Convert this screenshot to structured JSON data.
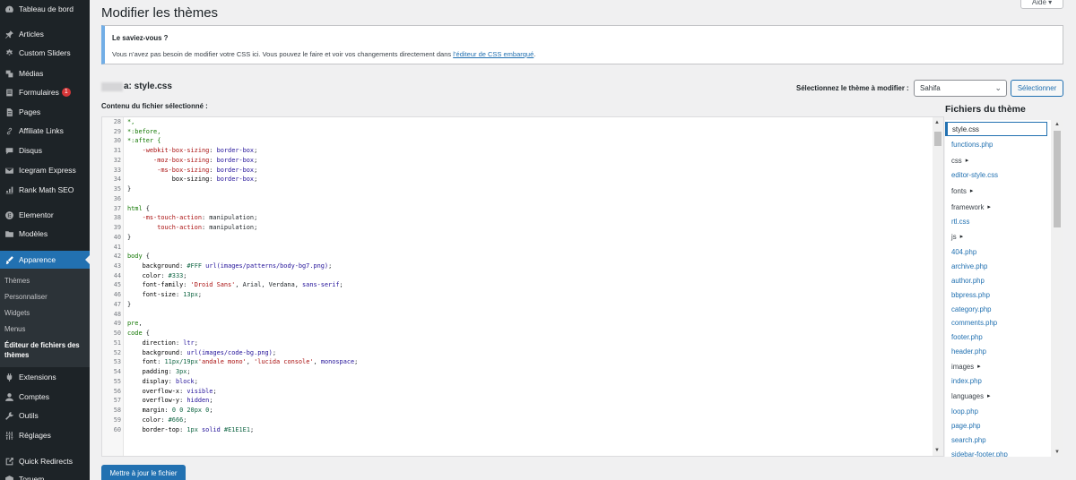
{
  "sidebar": {
    "items": [
      {
        "label": "Tableau de bord",
        "icon": "dashboard-icon"
      },
      {
        "label": "Articles",
        "icon": "pin-icon"
      },
      {
        "label": "Custom Sliders",
        "icon": "gear-icon"
      },
      {
        "label": "Médias",
        "icon": "media-icon"
      },
      {
        "label": "Formulaires",
        "icon": "forms-icon",
        "badge": "1"
      },
      {
        "label": "Pages",
        "icon": "page-icon"
      },
      {
        "label": "Affiliate Links",
        "icon": "link-icon"
      },
      {
        "label": "Disqus",
        "icon": "comment-icon"
      },
      {
        "label": "Icegram Express",
        "icon": "mail-icon"
      },
      {
        "label": "Rank Math SEO",
        "icon": "chart-icon"
      },
      {
        "label": "Elementor",
        "icon": "elementor-icon"
      },
      {
        "label": "Modèles",
        "icon": "folder-icon"
      },
      {
        "label": "Apparence",
        "icon": "brush-icon"
      },
      {
        "label": "Extensions",
        "icon": "plugin-icon"
      },
      {
        "label": "Comptes",
        "icon": "user-icon"
      },
      {
        "label": "Outils",
        "icon": "wrench-icon"
      },
      {
        "label": "Réglages",
        "icon": "settings-icon"
      },
      {
        "label": "Quick Redirects",
        "icon": "redirect-icon"
      },
      {
        "label": "Toruem",
        "icon": "cube-icon"
      }
    ],
    "submenu": [
      "Thèmes",
      "Personnaliser",
      "Widgets",
      "Menus",
      "Éditeur de fichiers des thèmes"
    ]
  },
  "page": {
    "title": "Modifier les thèmes",
    "help": "Aide ▾"
  },
  "notice": {
    "title": "Le saviez-vous ?",
    "text": "Vous n’avez pas besoin de modifier votre CSS ici. Vous pouvez le faire et voir vos changements directement dans ",
    "link": "l’éditeur de CSS embarqué",
    "end": "."
  },
  "file_heading": "a: style.css",
  "theme_select": {
    "label": "Sélectionnez le thème à modifier :",
    "value": "Sahifa",
    "button": "Sélectionner"
  },
  "content_label": "Contenu du fichier sélectionné :",
  "code_lines": [
    {
      "n": "28",
      "t": [
        [
          "*,",
          "tok-sel"
        ]
      ]
    },
    {
      "n": "29",
      "t": [
        [
          "*:before,",
          "tok-sel"
        ]
      ]
    },
    {
      "n": "30",
      "t": [
        [
          "*:after {",
          "tok-sel"
        ]
      ]
    },
    {
      "n": "31",
      "t": [
        [
          "    -webkit-box-sizing",
          "tok-vendor"
        ],
        [
          ": ",
          ""
        ],
        [
          "border-box",
          "tok-val"
        ],
        [
          ";",
          ""
        ]
      ]
    },
    {
      "n": "32",
      "t": [
        [
          "       -moz-box-sizing",
          "tok-vendor"
        ],
        [
          ": ",
          ""
        ],
        [
          "border-box",
          "tok-val"
        ],
        [
          ";",
          ""
        ]
      ]
    },
    {
      "n": "33",
      "t": [
        [
          "        -ms-box-sizing",
          "tok-vendor"
        ],
        [
          ": ",
          ""
        ],
        [
          "border-box",
          "tok-val"
        ],
        [
          ";",
          ""
        ]
      ]
    },
    {
      "n": "34",
      "t": [
        [
          "            box-sizing",
          "tok-prop"
        ],
        [
          ": ",
          ""
        ],
        [
          "border-box",
          "tok-val"
        ],
        [
          ";",
          ""
        ]
      ]
    },
    {
      "n": "35",
      "t": [
        [
          "}",
          ""
        ]
      ]
    },
    {
      "n": "36",
      "t": []
    },
    {
      "n": "37",
      "t": [
        [
          "html",
          "tok-sel"
        ],
        [
          " {",
          ""
        ]
      ]
    },
    {
      "n": "38",
      "t": [
        [
          "    -ms-touch-action",
          "tok-vendor"
        ],
        [
          ": manipulation;",
          ""
        ]
      ]
    },
    {
      "n": "39",
      "t": [
        [
          "        touch-action",
          "tok-vendor"
        ],
        [
          ": manipulation;",
          ""
        ]
      ]
    },
    {
      "n": "40",
      "t": [
        [
          "}",
          ""
        ]
      ]
    },
    {
      "n": "41",
      "t": []
    },
    {
      "n": "42",
      "t": [
        [
          "body",
          "tok-sel"
        ],
        [
          " {",
          ""
        ]
      ]
    },
    {
      "n": "43",
      "t": [
        [
          "    background",
          "tok-prop"
        ],
        [
          ": ",
          ""
        ],
        [
          "#FFF",
          "tok-num"
        ],
        [
          " ",
          ""
        ],
        [
          "url(images/patterns/body-bg7.png)",
          "tok-val"
        ],
        [
          ";",
          ""
        ]
      ]
    },
    {
      "n": "44",
      "t": [
        [
          "    color",
          "tok-prop"
        ],
        [
          ": ",
          ""
        ],
        [
          "#333",
          "tok-num"
        ],
        [
          ";",
          ""
        ]
      ]
    },
    {
      "n": "45",
      "t": [
        [
          "    font-family",
          "tok-prop"
        ],
        [
          ": ",
          ""
        ],
        [
          "'Droid Sans'",
          "tok-str"
        ],
        [
          ", Arial, Verdana, ",
          ""
        ],
        [
          "sans-serif",
          "tok-val"
        ],
        [
          ";",
          ""
        ]
      ]
    },
    {
      "n": "46",
      "t": [
        [
          "    font-size",
          "tok-prop"
        ],
        [
          ": ",
          ""
        ],
        [
          "13px",
          "tok-num"
        ],
        [
          ";",
          ""
        ]
      ]
    },
    {
      "n": "47",
      "t": [
        [
          "}",
          ""
        ]
      ]
    },
    {
      "n": "48",
      "t": []
    },
    {
      "n": "49",
      "t": [
        [
          "pre",
          "tok-sel"
        ],
        [
          ",",
          ""
        ]
      ]
    },
    {
      "n": "50",
      "t": [
        [
          "code",
          "tok-sel"
        ],
        [
          " {",
          ""
        ]
      ]
    },
    {
      "n": "51",
      "t": [
        [
          "    direction",
          "tok-prop"
        ],
        [
          ": ",
          ""
        ],
        [
          "ltr",
          "tok-val"
        ],
        [
          ";",
          ""
        ]
      ]
    },
    {
      "n": "52",
      "t": [
        [
          "    background",
          "tok-prop"
        ],
        [
          ": ",
          ""
        ],
        [
          "url(images/code-bg.png)",
          "tok-val"
        ],
        [
          ";",
          ""
        ]
      ]
    },
    {
      "n": "53",
      "t": [
        [
          "    font",
          "tok-prop"
        ],
        [
          ": ",
          ""
        ],
        [
          "11px/19px",
          "tok-num"
        ],
        [
          "'andale mono'",
          "tok-str"
        ],
        [
          ", ",
          ""
        ],
        [
          "'lucida console'",
          "tok-str"
        ],
        [
          ", ",
          ""
        ],
        [
          "monospace",
          "tok-val"
        ],
        [
          ";",
          ""
        ]
      ]
    },
    {
      "n": "54",
      "t": [
        [
          "    padding",
          "tok-prop"
        ],
        [
          ": ",
          ""
        ],
        [
          "3px",
          "tok-num"
        ],
        [
          ";",
          ""
        ]
      ]
    },
    {
      "n": "55",
      "t": [
        [
          "    display",
          "tok-prop"
        ],
        [
          ": ",
          ""
        ],
        [
          "block",
          "tok-val"
        ],
        [
          ";",
          ""
        ]
      ]
    },
    {
      "n": "56",
      "t": [
        [
          "    overflow-x",
          "tok-prop"
        ],
        [
          ": ",
          ""
        ],
        [
          "visible",
          "tok-val"
        ],
        [
          ";",
          ""
        ]
      ]
    },
    {
      "n": "57",
      "t": [
        [
          "    overflow-y",
          "tok-prop"
        ],
        [
          ": ",
          ""
        ],
        [
          "hidden",
          "tok-val"
        ],
        [
          ";",
          ""
        ]
      ]
    },
    {
      "n": "58",
      "t": [
        [
          "    margin",
          "tok-prop"
        ],
        [
          ": ",
          ""
        ],
        [
          "0 0 20px 0",
          "tok-num"
        ],
        [
          ";",
          ""
        ]
      ]
    },
    {
      "n": "59",
      "t": [
        [
          "    color",
          "tok-prop"
        ],
        [
          ": ",
          ""
        ],
        [
          "#666",
          "tok-num"
        ],
        [
          ";",
          ""
        ]
      ]
    },
    {
      "n": "60",
      "t": [
        [
          "    border-top",
          "tok-prop"
        ],
        [
          ": ",
          ""
        ],
        [
          "1px",
          "tok-num"
        ],
        [
          " ",
          ""
        ],
        [
          "solid",
          "tok-val"
        ],
        [
          " ",
          ""
        ],
        [
          "#E1E1E1",
          "tok-num"
        ],
        [
          ";",
          ""
        ]
      ]
    }
  ],
  "files": {
    "title": "Fichiers du thème",
    "items": [
      {
        "name": "style.css",
        "type": "file",
        "selected": true
      },
      {
        "name": "functions.php",
        "type": "file"
      },
      {
        "name": "css",
        "type": "dir"
      },
      {
        "name": "editor-style.css",
        "type": "file"
      },
      {
        "name": "fonts",
        "type": "dir"
      },
      {
        "name": "framework",
        "type": "dir"
      },
      {
        "name": "rtl.css",
        "type": "file"
      },
      {
        "name": "js",
        "type": "dir"
      },
      {
        "name": "404.php",
        "type": "file"
      },
      {
        "name": "archive.php",
        "type": "file"
      },
      {
        "name": "author.php",
        "type": "file"
      },
      {
        "name": "bbpress.php",
        "type": "file"
      },
      {
        "name": "category.php",
        "type": "file"
      },
      {
        "name": "comments.php",
        "type": "file"
      },
      {
        "name": "footer.php",
        "type": "file"
      },
      {
        "name": "header.php",
        "type": "file"
      },
      {
        "name": "images",
        "type": "dir"
      },
      {
        "name": "index.php",
        "type": "file"
      },
      {
        "name": "languages",
        "type": "dir"
      },
      {
        "name": "loop.php",
        "type": "file"
      },
      {
        "name": "page.php",
        "type": "file"
      },
      {
        "name": "search.php",
        "type": "file"
      },
      {
        "name": "sidebar-footer.php",
        "type": "file"
      }
    ]
  },
  "update_button": "Mettre à jour le fichier",
  "colors": {
    "accent": "#2271b1",
    "sidebar": "#1d2327",
    "notice_border": "#72aee6",
    "badge": "#d63638"
  }
}
